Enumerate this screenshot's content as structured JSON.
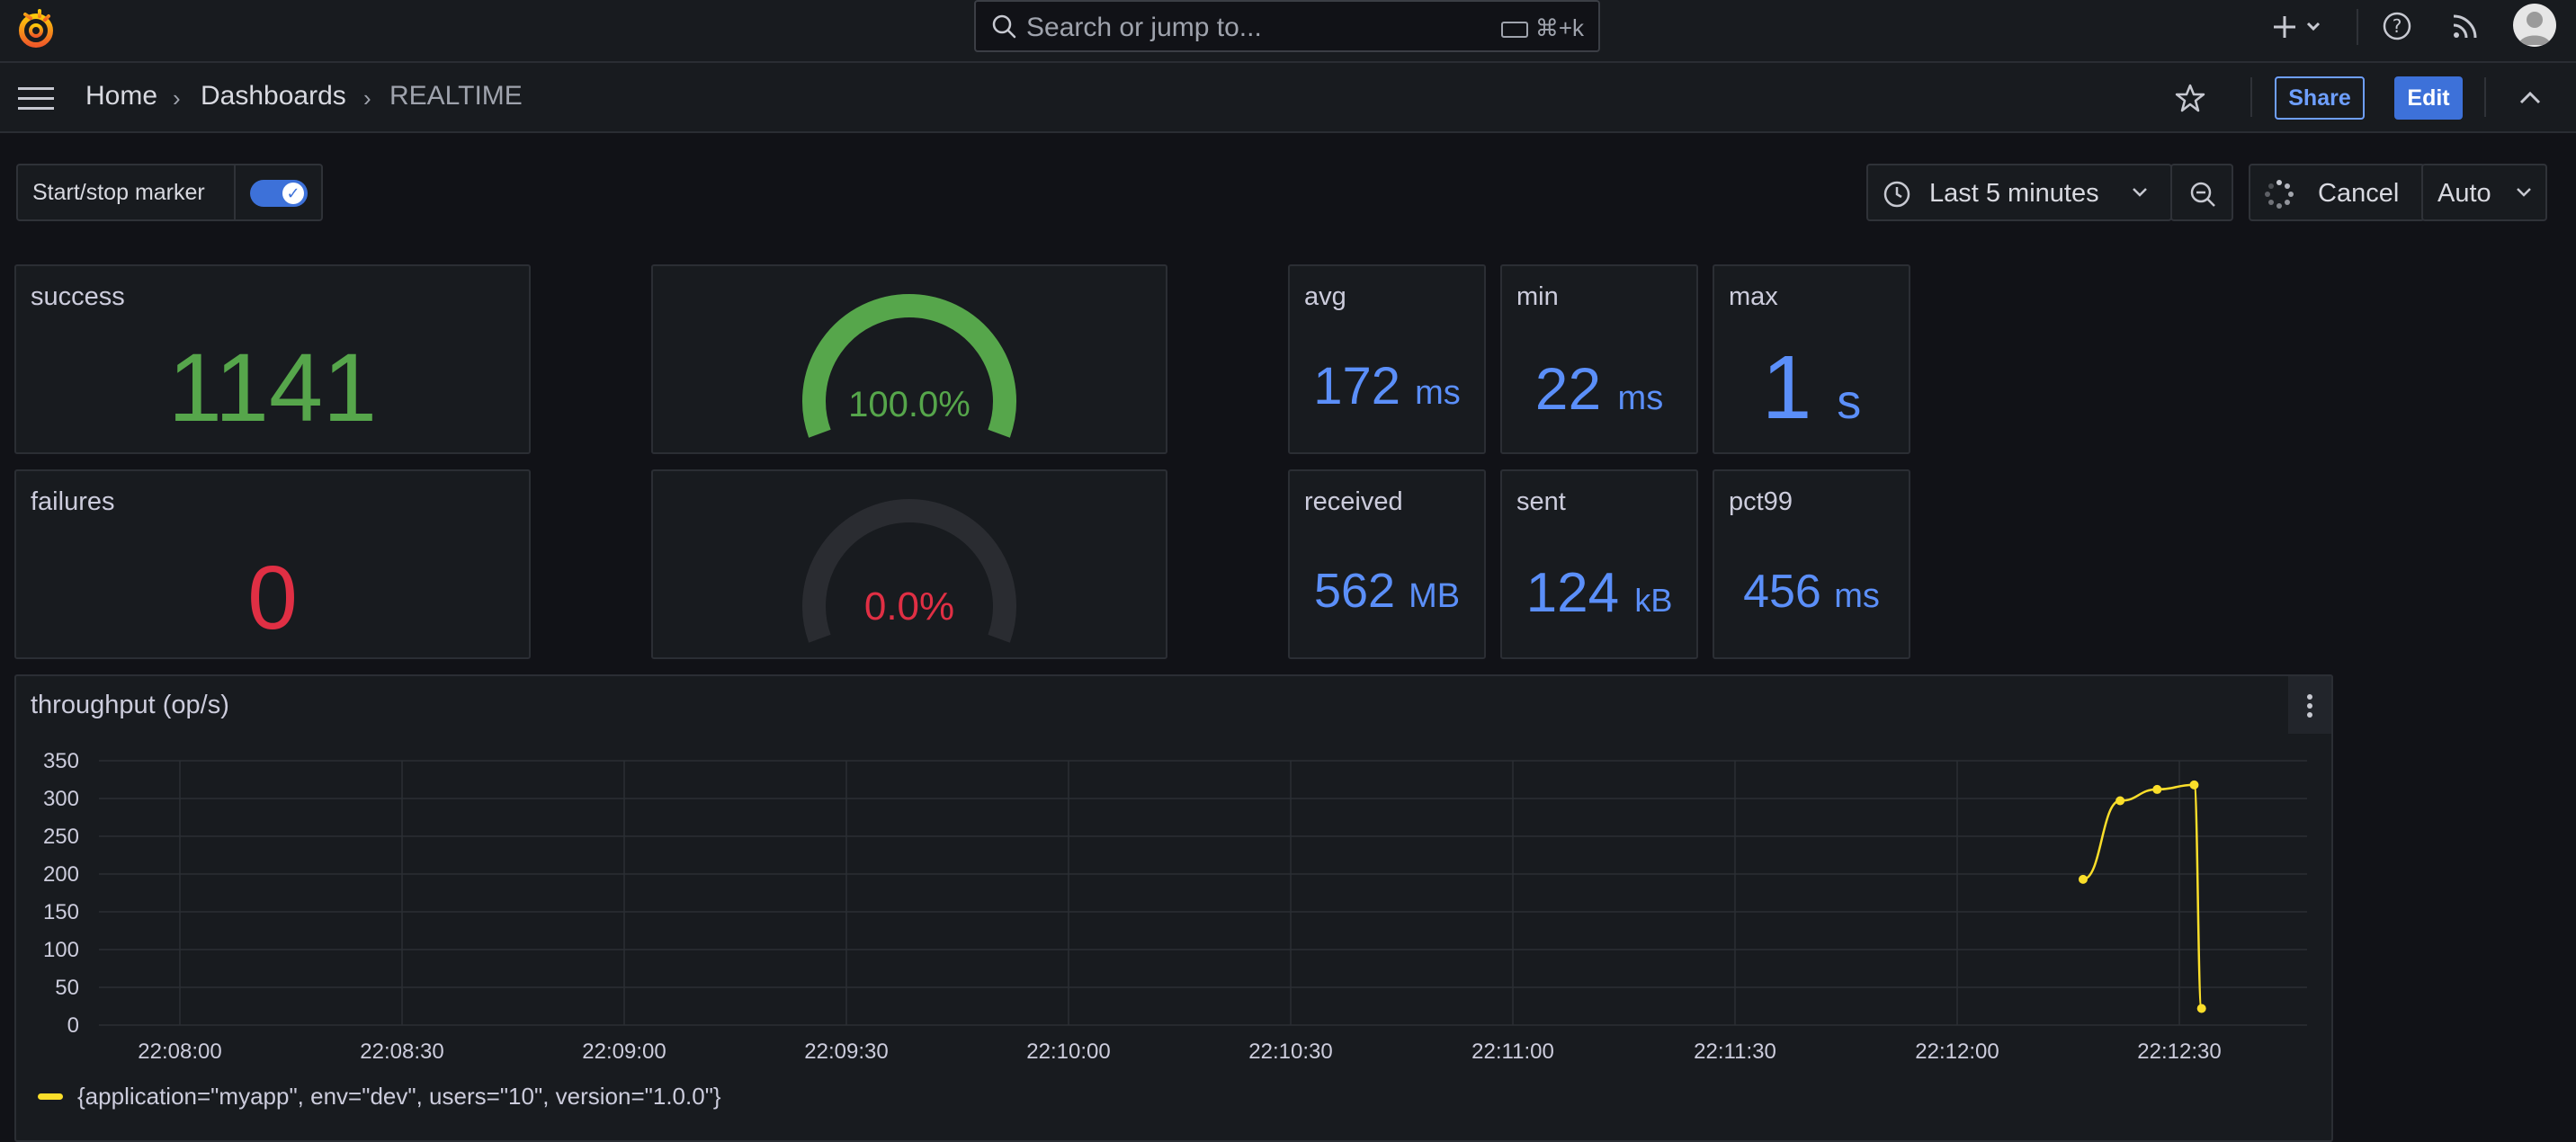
{
  "topbar": {
    "search_placeholder": "Search or jump to...",
    "search_shortcut": "⌘+k"
  },
  "breadcrumb": {
    "home": "Home",
    "dashboards": "Dashboards",
    "current": "REALTIME"
  },
  "nav_actions": {
    "share": "Share",
    "edit": "Edit"
  },
  "controls": {
    "marker_label": "Start/stop marker",
    "marker_on": true,
    "time_range": "Last 5 minutes",
    "cancel": "Cancel",
    "refresh": "Auto"
  },
  "stats": {
    "success": {
      "title": "success",
      "value": "1141"
    },
    "failures": {
      "title": "failures",
      "value": "0"
    },
    "gauge_success": {
      "value": "100.0%",
      "fraction": 1.0,
      "color": "#56a64b"
    },
    "gauge_failure": {
      "value": "0.0%",
      "fraction": 0.0,
      "color": "#e02f44"
    },
    "avg": {
      "title": "avg",
      "value": "172",
      "unit": "ms"
    },
    "min": {
      "title": "min",
      "value": "22",
      "unit": "ms"
    },
    "max": {
      "title": "max",
      "value": "1",
      "unit": "s"
    },
    "received": {
      "title": "received",
      "value": "562",
      "unit": "MB"
    },
    "sent": {
      "title": "sent",
      "value": "124",
      "unit": "kB"
    },
    "pct99": {
      "title": "pct99",
      "value": "456",
      "unit": "ms"
    }
  },
  "colors": {
    "success": "#56a64b",
    "failure": "#e02f44",
    "stat_blue": "#5b8ff9",
    "series": "#fade2a"
  },
  "chart_data": {
    "type": "line",
    "title": "throughput (op/s)",
    "xlabel": "",
    "ylabel": "",
    "ylim": [
      0,
      350
    ],
    "yticks": [
      "350",
      "300",
      "250",
      "200",
      "150",
      "100",
      "50",
      "0"
    ],
    "xticks": [
      "22:08:00",
      "22:08:30",
      "22:09:00",
      "22:09:30",
      "22:10:00",
      "22:10:30",
      "22:11:00",
      "22:11:30",
      "22:12:00",
      "22:12:30"
    ],
    "grid": true,
    "legend_position": "bottom-left",
    "series": [
      {
        "name": "{application=\"myapp\", env=\"dev\", users=\"10\", version=\"1.0.0\"}",
        "color": "#fade2a",
        "points": [
          {
            "x": "22:12:17",
            "y": 193
          },
          {
            "x": "22:12:22",
            "y": 297
          },
          {
            "x": "22:12:27",
            "y": 312
          },
          {
            "x": "22:12:32",
            "y": 318
          },
          {
            "x": "22:12:33",
            "y": 22
          }
        ]
      }
    ]
  }
}
